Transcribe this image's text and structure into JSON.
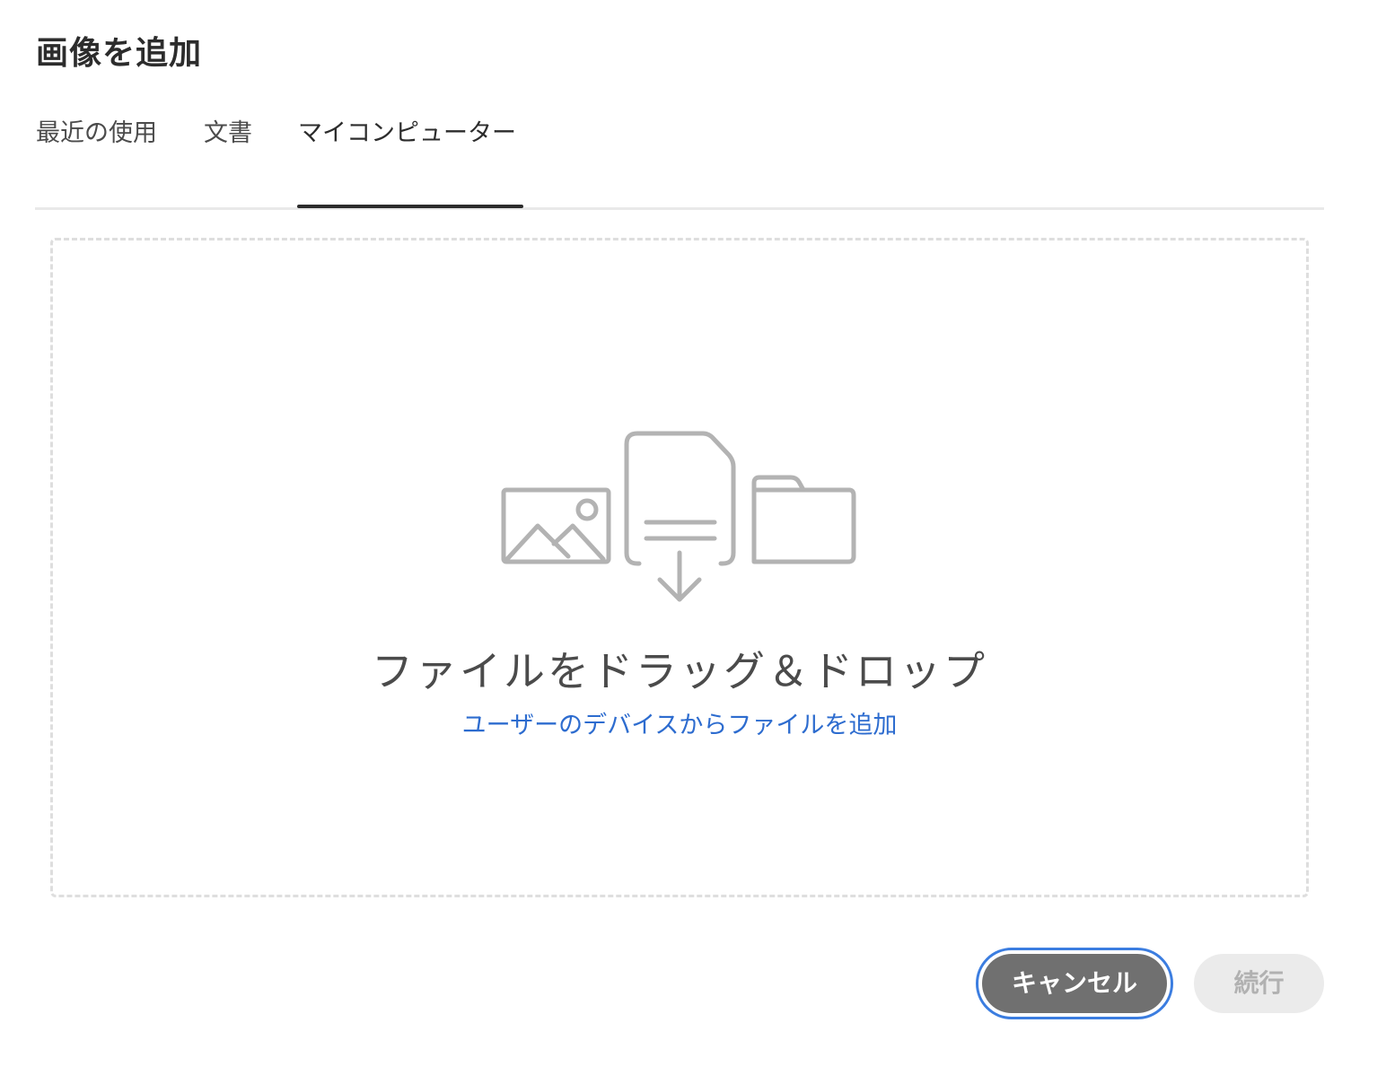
{
  "dialog": {
    "title": "画像を追加"
  },
  "tabs": [
    {
      "label": "最近の使用",
      "selected": false
    },
    {
      "label": "文書",
      "selected": false
    },
    {
      "label": "マイコンピューター",
      "selected": true
    }
  ],
  "dropzone": {
    "title": "ファイルをドラッグ＆ドロップ",
    "browse_link": "ユーザーのデバイスからファイルを追加",
    "icons": [
      "image-icon",
      "document-download-icon",
      "folder-icon"
    ]
  },
  "footer": {
    "cancel_label": "キャンセル",
    "continue_label": "続行",
    "continue_enabled": false
  },
  "colors": {
    "accent": "#2d6ccf",
    "focus_ring": "#3b7de0",
    "cancel_bg": "#707070",
    "disabled_bg": "#ebebeb",
    "disabled_text": "#b1b1b1",
    "icon_stroke": "#b3b3b3"
  }
}
